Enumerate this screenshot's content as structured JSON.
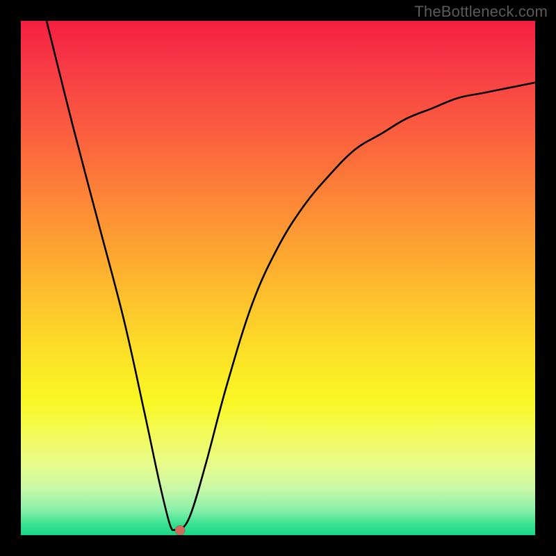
{
  "attribution": "TheBottleneck.com",
  "colors": {
    "page_bg": "#000000",
    "gradient_top": "#f51e40",
    "gradient_bottom": "#17d885",
    "curve": "#000000",
    "marker": "#cf6a5d",
    "attribution_text": "#5b5b5b"
  },
  "chart_data": {
    "type": "line",
    "title": "",
    "xlabel": "",
    "ylabel": "",
    "xlim": [
      0,
      100
    ],
    "ylim": [
      0,
      100
    ],
    "grid": false,
    "legend": false,
    "series": [
      {
        "name": "bottleneck-curve",
        "x": [
          5,
          10,
          15,
          20,
          24,
          27,
          29,
          30,
          31,
          33,
          36,
          40,
          45,
          50,
          55,
          60,
          65,
          70,
          75,
          80,
          85,
          90,
          95,
          100
        ],
        "values": [
          100,
          80,
          61,
          42,
          24,
          10,
          2,
          1,
          1,
          4,
          14,
          29,
          45,
          56,
          64,
          70,
          75,
          78,
          81,
          83,
          85,
          86,
          87,
          88
        ]
      }
    ],
    "marker": {
      "x": 31,
      "y": 1
    },
    "notes": "Values eyeballed from the figure; y = 0 corresponds to bottom (green), y = 100 to top (red)."
  }
}
